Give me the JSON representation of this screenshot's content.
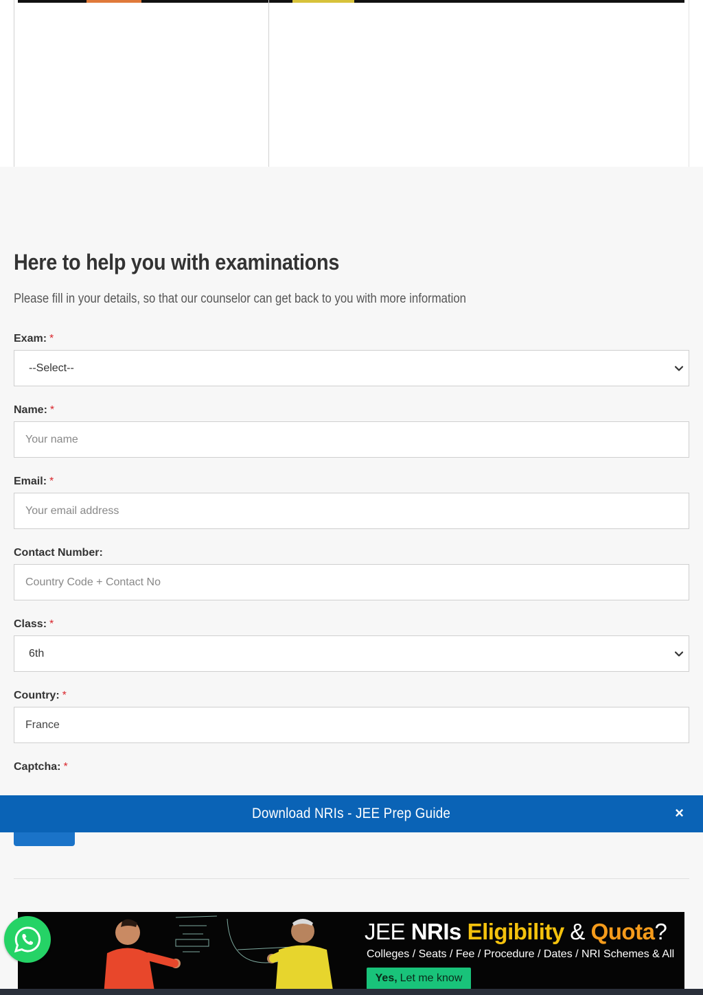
{
  "form": {
    "title": "Here to help you with examinations",
    "subtitle": "Please fill in your details, so that our counselor can get back to you with more information",
    "required_mark": "*",
    "fields": {
      "exam": {
        "label": "Exam:",
        "value": "--Select--",
        "required": true
      },
      "name": {
        "label": "Name:",
        "placeholder": "Your name",
        "required": true
      },
      "email": {
        "label": "Email:",
        "placeholder": "Your email address",
        "required": true
      },
      "contact": {
        "label": "Contact Number:",
        "placeholder": "Country Code + Contact No",
        "required": false
      },
      "class": {
        "label": "Class:",
        "value": "6th",
        "required": true
      },
      "country": {
        "label": "Country:",
        "value": "France",
        "required": true
      },
      "captcha": {
        "label": "Captcha:",
        "required": true
      }
    }
  },
  "sticky_banner": {
    "text": "Download NRIs - JEE Prep Guide",
    "close": "×"
  },
  "promo": {
    "headline_a": "JEE ",
    "headline_b": "NRIs ",
    "headline_c": "Eligibility",
    "headline_d": " & ",
    "headline_e": "Quota",
    "headline_f": "?",
    "subline": "Colleges / Seats / Fee / Procedure / Dates / NRI Schemes & All",
    "cta_bold": "Yes,",
    "cta_rest": "Let me know"
  },
  "colors": {
    "accent_blue": "#0a63b6",
    "button_blue": "#1a73c8",
    "required_red": "#d9262c",
    "whatsapp_green": "#25d366",
    "promo_yellow": "#f4c20d",
    "promo_orange": "#f59b1b",
    "cta_green": "#19c37a"
  },
  "icons": {
    "select_arrow": "chevron-down-icon",
    "close": "close-icon",
    "whatsapp": "whatsapp-icon"
  }
}
